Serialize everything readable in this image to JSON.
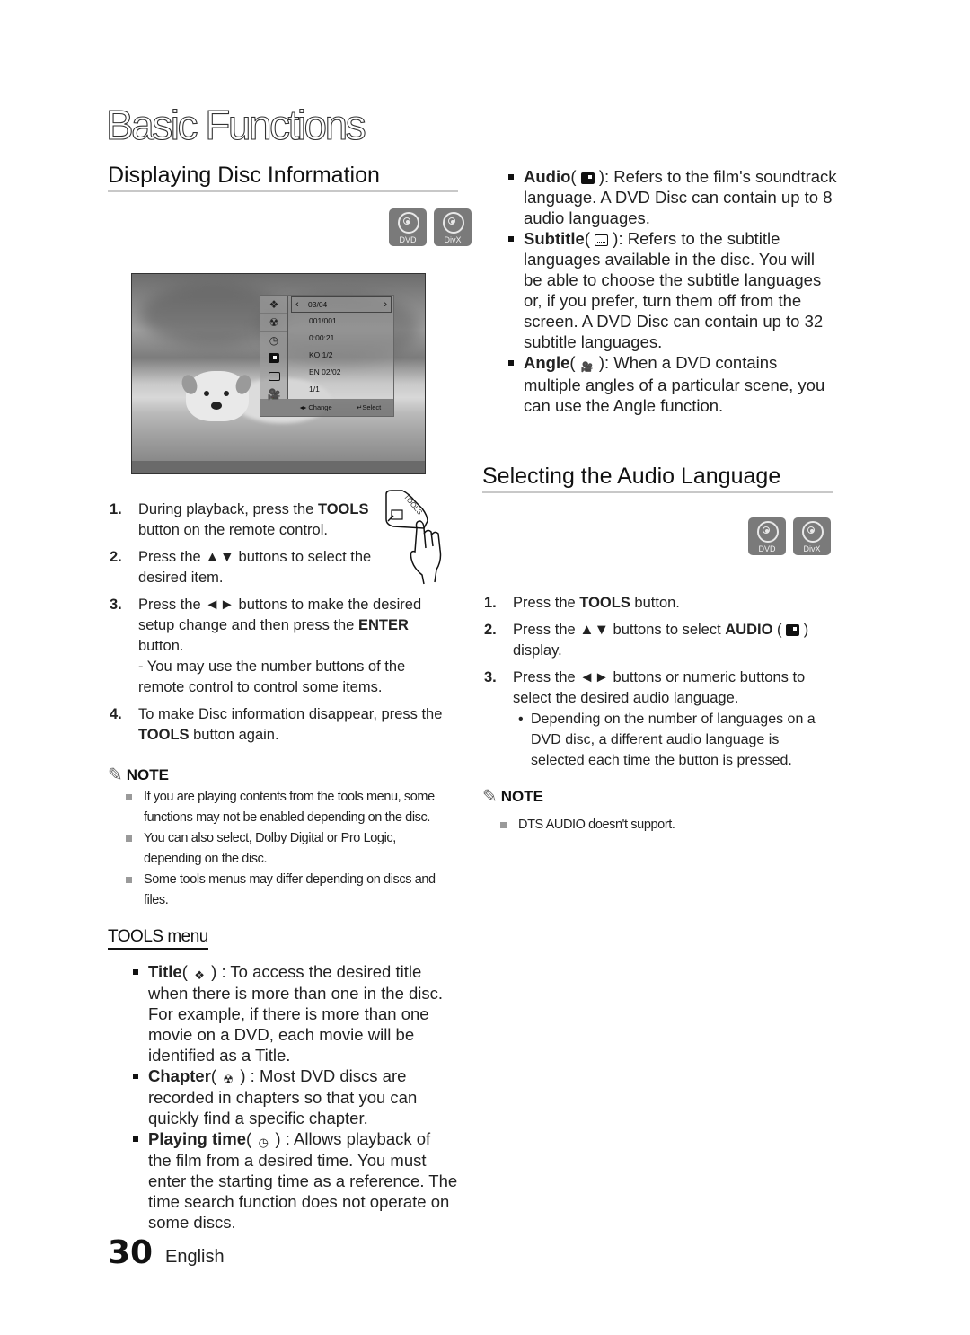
{
  "page": {
    "title": "Basic Functions",
    "number": "30",
    "language": "English"
  },
  "left": {
    "section_title": "Displaying Disc Information",
    "badges": [
      "DVD",
      "DivX"
    ],
    "osd": {
      "rows": [
        "03/04",
        "001/001",
        "0:00:21",
        "KO 1/2",
        "EN 02/02",
        "1/1"
      ],
      "icons": [
        "title-icon",
        "chapter-icon",
        "playing-time-icon",
        "audio-icon",
        "subtitle-icon",
        "angle-icon"
      ],
      "footer_change": "Change",
      "footer_select": "Select"
    },
    "remote_button_label": "TOOLS",
    "steps": [
      {
        "num": "1.",
        "pre": "During playback, press the ",
        "bold": "TOOLS",
        "post": " button on the remote control."
      },
      {
        "num": "2.",
        "text": "Press the ▲▼ buttons to select the desired item."
      },
      {
        "num": "3.",
        "pre": "Press the ◄► buttons to make the desired setup change and then press the ",
        "bold": "ENTER",
        "post": " button.",
        "sub": "- You may use the number buttons of the remote control to control some items."
      },
      {
        "num": "4.",
        "pre": "To make Disc information disappear, press the ",
        "bold": "TOOLS",
        "post": " button again."
      }
    ],
    "note_heading": "NOTE",
    "notes": [
      "If you are playing contents from the tools menu, some functions may not be enabled depending on the disc.",
      "You can also select, Dolby Digital or Pro Logic, depending on the disc.",
      "Some tools menus may differ depending on discs and files."
    ],
    "tools_menu_heading": "TOOLS menu",
    "tools_items": [
      {
        "name": "Title",
        "desc": " : To access the desired title when there is more than one in the disc. For example, if there is more than one movie on a DVD, each movie will be identified as a Title."
      },
      {
        "name": "Chapter",
        "desc": " : Most DVD discs are recorded in chapters so that you can quickly find a specific chapter."
      },
      {
        "name": "Playing time",
        "desc": " : Allows playback of the film from a desired time. You must enter the starting time as a reference. The time search function does not operate on some discs."
      }
    ]
  },
  "right": {
    "tools_items": [
      {
        "name": "Audio",
        "desc": ": Refers to the film's soundtrack language. A DVD Disc can contain up to 8 audio languages."
      },
      {
        "name": "Subtitle",
        "desc": ": Refers to the subtitle languages available in the disc. You will be able to choose the subtitle languages or, if you prefer, turn them off from the screen. A DVD Disc can contain up to 32 subtitle languages."
      },
      {
        "name": "Angle",
        "desc": ": When a DVD contains multiple angles of a particular scene, you can use the Angle function."
      }
    ],
    "section_title": "Selecting the Audio Language",
    "badges": [
      "DVD",
      "DivX"
    ],
    "steps": [
      {
        "num": "1.",
        "pre": "Press the ",
        "bold": "TOOLS",
        "post": " button."
      },
      {
        "num": "2.",
        "pre": "Press the ▲▼ buttons to select ",
        "bold": "AUDIO",
        "post": " display."
      },
      {
        "num": "3.",
        "text": "Press the ◄► buttons or numeric buttons to select the desired audio language.",
        "sub": "Depending on the number of languages on a DVD disc, a different audio language is selected each time the button is pressed."
      }
    ],
    "note_heading": "NOTE",
    "notes": [
      "DTS AUDIO doesn't support."
    ]
  }
}
